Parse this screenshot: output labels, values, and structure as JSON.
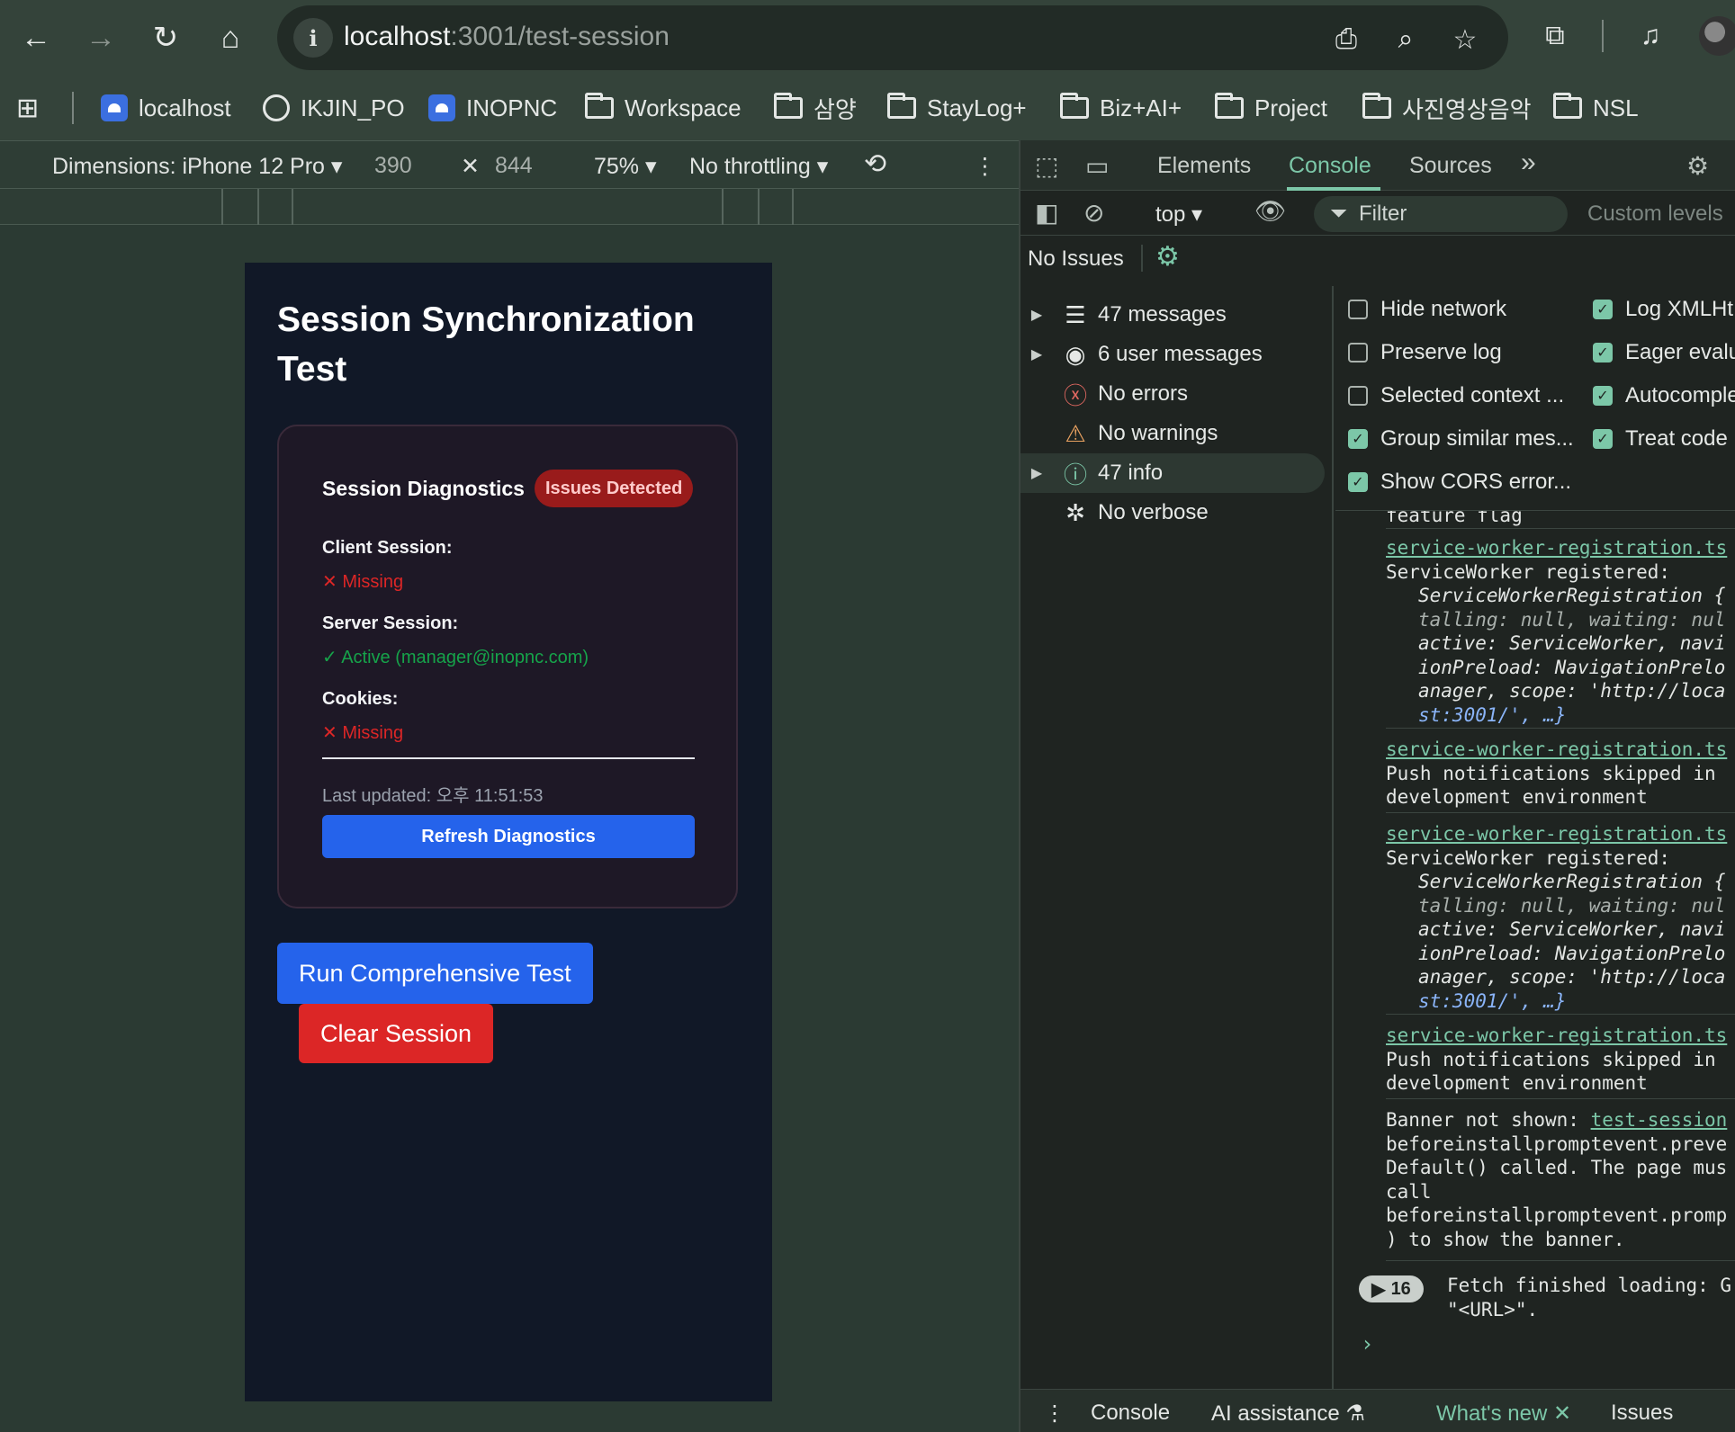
{
  "browser": {
    "url_host": "localhost",
    "url_path": ":3001/test-session",
    "bookmarks": [
      "localhost",
      "IKJIN_PO",
      "INOPNC",
      "Workspace",
      "삼양",
      "StayLog+",
      "Biz+AI+",
      "Project",
      "사진영상음악",
      "NSL"
    ]
  },
  "device_toolbar": {
    "dimensions": "Dimensions: iPhone 12 Pro",
    "width": "390",
    "height": "844",
    "zoom": "75%",
    "throttling": "No throttling"
  },
  "page": {
    "title": "Session Synchronization Test",
    "diagnostics": {
      "title": "Session Diagnostics",
      "badge": "Issues Detected",
      "client_label": "Client Session:",
      "client_value": "✕ Missing",
      "server_label": "Server Session:",
      "server_value": "✓ Active (manager@inopnc.com)",
      "cookies_label": "Cookies:",
      "cookies_value": "✕ Missing",
      "last_updated": "Last updated: 오후 11:51:53",
      "refresh_label": "Refresh Diagnostics"
    },
    "run_test_label": "Run Comprehensive Test",
    "clear_session_label": "Clear Session"
  },
  "devtools": {
    "tabs": [
      "Elements",
      "Console",
      "Sources"
    ],
    "active_tab": "Console",
    "context": "top",
    "filter_placeholder": "Filter",
    "levels": "Custom levels",
    "issues": "No Issues",
    "sidebar": [
      {
        "label": "47 messages",
        "icon": "list-icon"
      },
      {
        "label": "6 user messages",
        "icon": "user-icon"
      },
      {
        "label": "No errors",
        "icon": "error-icon"
      },
      {
        "label": "No warnings",
        "icon": "warning-icon"
      },
      {
        "label": "47 info",
        "icon": "info-icon"
      },
      {
        "label": "No verbose",
        "icon": "bug-icon"
      }
    ],
    "settings_left": [
      {
        "label": "Hide network",
        "checked": false
      },
      {
        "label": "Preserve log",
        "checked": false
      },
      {
        "label": "Selected context ...",
        "checked": false
      },
      {
        "label": "Group similar mes...",
        "checked": true
      },
      {
        "label": "Show CORS error...",
        "checked": true
      }
    ],
    "settings_right": [
      {
        "label": "Log XMLHt",
        "checked": true
      },
      {
        "label": "Eager evalu",
        "checked": true
      },
      {
        "label": "Autocomple",
        "checked": true
      },
      {
        "label": "Treat code",
        "checked": true
      }
    ],
    "log": {
      "partial_top": "feature flag",
      "source": "service-worker-registration.ts",
      "sw_registered": "ServiceWorker registered:",
      "sw_obj1": "ServiceWorkerRegistration {",
      "sw_obj2": "talling: null, waiting: nul",
      "sw_obj3": "active: ServiceWorker, navi",
      "sw_obj4": "ionPreload: NavigationPrelo",
      "sw_obj5": "anager, scope: 'http://loca",
      "sw_obj6": "st:3001/', …}",
      "push1": "Push notifications skipped in",
      "push2": "development environment",
      "banner_label": "Banner not shown:",
      "banner_link": "test-session",
      "banner2": "beforeinstallpromptevent.preve",
      "banner3": "Default() called. The page mus",
      "banner4": "call",
      "banner5": "beforeinstallpromptevent.promp",
      "banner6": ") to show the banner.",
      "fetch_count": "16",
      "fetch1": "Fetch finished loading: G",
      "fetch2": "\"<URL>\"."
    },
    "bottom_tabs": [
      "Console",
      "AI assistance",
      "What's new",
      "Issues"
    ]
  }
}
